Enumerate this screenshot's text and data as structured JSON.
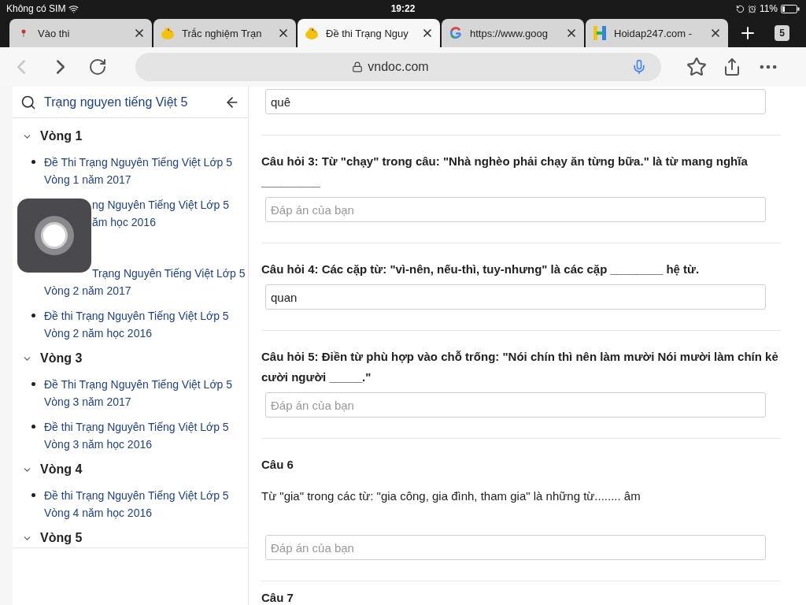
{
  "status_bar": {
    "carrier": "Không có SIM",
    "time": "19:22",
    "battery": "11%"
  },
  "tabs": [
    {
      "title": "Vào thi",
      "kind": "pin",
      "selected": false
    },
    {
      "title": "Trắc nghiệm Trạn",
      "kind": "chick",
      "selected": false
    },
    {
      "title": "Đề thi Trạng Nguy",
      "kind": "chick",
      "selected": true
    },
    {
      "title": "https://www.goog",
      "kind": "google",
      "selected": false
    },
    {
      "title": "Hoidap247.com -",
      "kind": "h",
      "selected": false
    }
  ],
  "tab_count": "5",
  "toolbar": {
    "back_disabled": true,
    "url": "vndoc.com"
  },
  "sidebar": {
    "title": "Trạng nguyen tiếng Việt 5",
    "groups": [
      {
        "title": "Vòng 1",
        "expanded": true,
        "items": [
          {
            "bullet": true,
            "lines": [
              {
                "text": "Đề Thi Trạng Nguyên Tiếng Việt Lớp 5",
                "covered": false
              },
              {
                "text": "Vòng 1 năm 2017",
                "covered": false
              }
            ]
          },
          {
            "bullet": false,
            "lines": [
              {
                "text": "ng Nguyên Tiếng Việt Lớp 5",
                "covered": true
              },
              {
                "text": "ăm học 2016",
                "covered": true
              }
            ]
          }
        ]
      },
      {
        "expanded": true,
        "items": [
          {
            "bullet": false,
            "lines": [
              {
                "text": "Trạng Nguyên Tiếng Việt Lớp 5",
                "covered": true
              },
              {
                "text": "Vòng 2 năm 2017",
                "covered": false
              }
            ]
          },
          {
            "bullet": true,
            "lines": [
              {
                "text": "Đề thi Trạng Nguyên Tiếng Việt Lớp 5",
                "covered": false
              },
              {
                "text": "Vòng 2 năm học 2016",
                "covered": false
              }
            ]
          }
        ]
      },
      {
        "title": "Vòng 3",
        "expanded": true,
        "items": [
          {
            "bullet": true,
            "lines": [
              {
                "text": "Đề Thi Trạng Nguyên Tiếng Việt Lớp 5",
                "covered": false
              },
              {
                "text": "Vòng 3 năm 2017",
                "covered": false
              }
            ]
          },
          {
            "bullet": true,
            "lines": [
              {
                "text": "Đề thi Trạng Nguyên Tiếng Việt Lớp 5",
                "covered": false
              },
              {
                "text": "Vòng 3 năm học 2016",
                "covered": false
              }
            ]
          }
        ]
      },
      {
        "title": "Vòng 4",
        "expanded": true,
        "items": [
          {
            "bullet": true,
            "lines": [
              {
                "text": "Đề thi Trạng Nguyên Tiếng Việt Lớp 5",
                "covered": false
              },
              {
                "text": "Vòng 4 năm học 2016",
                "covered": false
              }
            ]
          }
        ]
      },
      {
        "title": "Vòng 5",
        "expanded": true
      }
    ]
  },
  "questions": [
    {
      "kind": "answer_only",
      "value": "quê"
    },
    {
      "kind": "question",
      "text": "Câu hỏi 3: Từ \"chạy\" trong câu: \"Nhà nghèo phải chạy ăn từng bữa.\" là từ mang nghĩa _________",
      "placeholder": "Đáp án của bạn"
    },
    {
      "kind": "question",
      "text": "Câu hỏi 4: Các cặp từ: \"vì-nên, nếu-thì, tuy-nhưng\" là các cặp ________ hệ từ.",
      "value": "quan"
    },
    {
      "kind": "question",
      "text": "Câu hỏi 5: Điền từ phù hợp vào chỗ trống: \"Nói chín thì nên làm mười Nói mười làm chín kẻ cười người _____.\"",
      "placeholder": "Đáp án của bạn"
    },
    {
      "kind": "numbered",
      "title": "Câu 6",
      "text": "Từ \"gia\" trong các từ: \"gia công, gia đình, tham gia\" là những từ........ âm",
      "placeholder": "Đáp án của bạn"
    },
    {
      "kind": "title_only",
      "title": "Câu 7"
    }
  ]
}
